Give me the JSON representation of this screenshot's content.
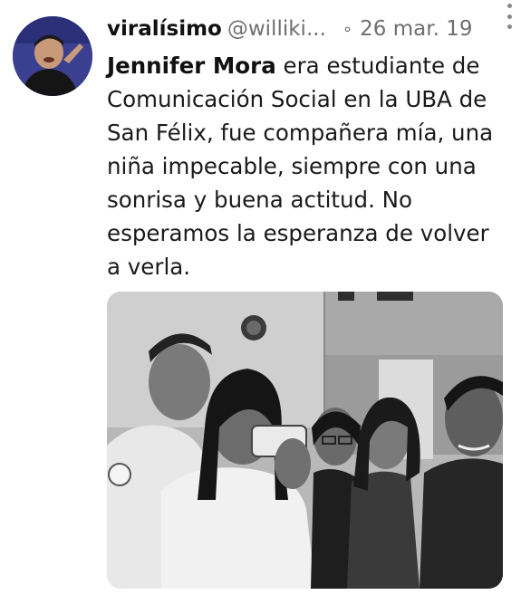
{
  "tweet": {
    "display_name": "viralísimo",
    "handle": "@williki...",
    "separator": "∘",
    "date": "26 mar. 19",
    "mention": "Jennifer Mora",
    "text": " era estudiante de Comunicación Social en la UBA de San Félix, fue compañera mía, una niña impecable, siempre con una sonrisa y buena actitud. No esperamos la esperanza de volver a verla.",
    "avatar_icon": "profile-avatar",
    "more_icon": "vertical-dots-icon",
    "media_description_icon": "photo-icon"
  },
  "colors": {
    "text": "#1a1a1a",
    "secondary": "#6f6f6f",
    "avatar_bg": "#3a3f8f"
  }
}
